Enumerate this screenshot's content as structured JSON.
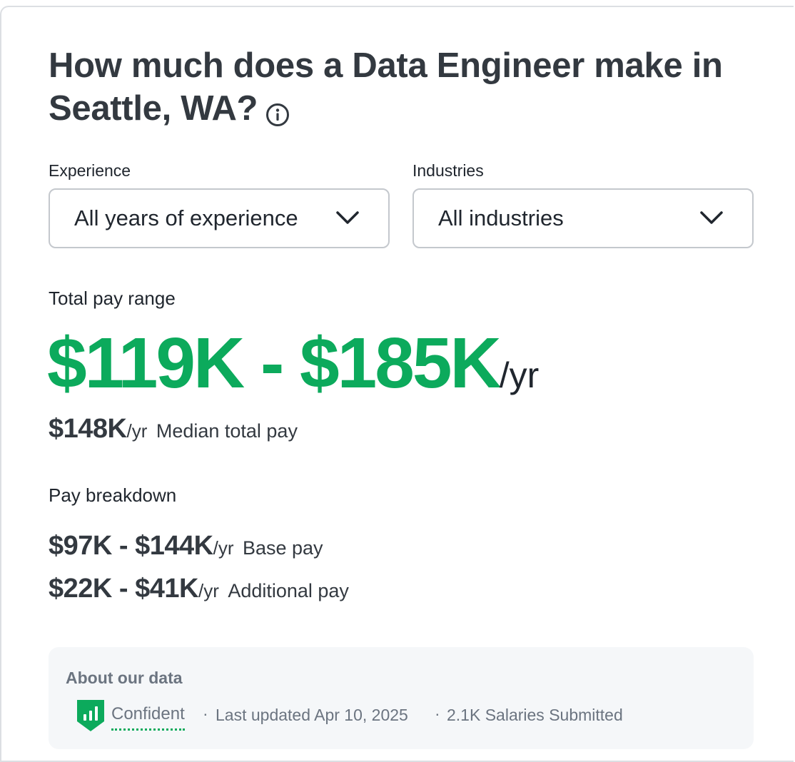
{
  "header": {
    "title": "How much does a Data Engineer make in Seattle, WA?",
    "info_icon": "info-circle-icon"
  },
  "filters": {
    "experience": {
      "label": "Experience",
      "selected": "All years of experience",
      "icon": "chevron-down-icon"
    },
    "industries": {
      "label": "Industries",
      "selected": "All industries",
      "icon": "chevron-down-icon"
    }
  },
  "total_pay": {
    "label": "Total pay range",
    "range": "$119K - $185K",
    "unit": "/yr",
    "median_value": "$148K",
    "median_unit": "/yr",
    "median_label": "Median total pay"
  },
  "breakdown": {
    "label": "Pay breakdown",
    "items": [
      {
        "range": "$97K - $144K",
        "unit": "/yr",
        "label": "Base pay"
      },
      {
        "range": "$22K - $41K",
        "unit": "/yr",
        "label": "Additional pay"
      }
    ]
  },
  "about": {
    "title": "About our data",
    "confidence": "Confident",
    "confidence_icon": "shield-bar-chart-icon",
    "separator": "·",
    "last_updated": "Last updated Apr 10, 2025",
    "salaries": "2.1K Salaries Submitted"
  },
  "colors": {
    "accent_green": "#0caa5c",
    "text_dark": "#333940",
    "text_muted": "#6b7480",
    "panel_bg": "#f5f7f9",
    "border": "#c4c8cd"
  }
}
